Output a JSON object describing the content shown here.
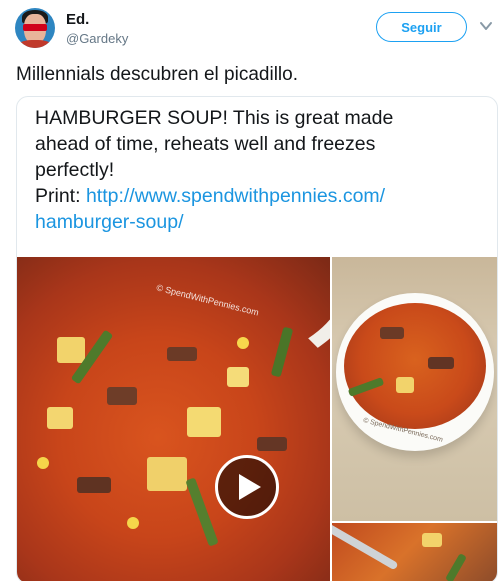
{
  "user": {
    "name": "Ed.",
    "handle": "@Gardeky"
  },
  "follow": {
    "label": "Seguir"
  },
  "tweet": {
    "text": "Millennials descubren el picadillo."
  },
  "card": {
    "line1": "HAMBURGER SOUP! This is great made",
    "line2": "ahead of time, reheats well and freezes",
    "line3": "perfectly!",
    "print_label": "Print: ",
    "link_part1": "http://www.spendwithpennies.com/",
    "link_part2": "hamburger-soup/"
  },
  "media": {
    "watermark_main": "© SpendWithPennies.com",
    "watermark_small": "© SpendWithPennies.com"
  },
  "colors": {
    "accent": "#1da1f2",
    "link": "#1b95e0",
    "muted": "#657786"
  }
}
